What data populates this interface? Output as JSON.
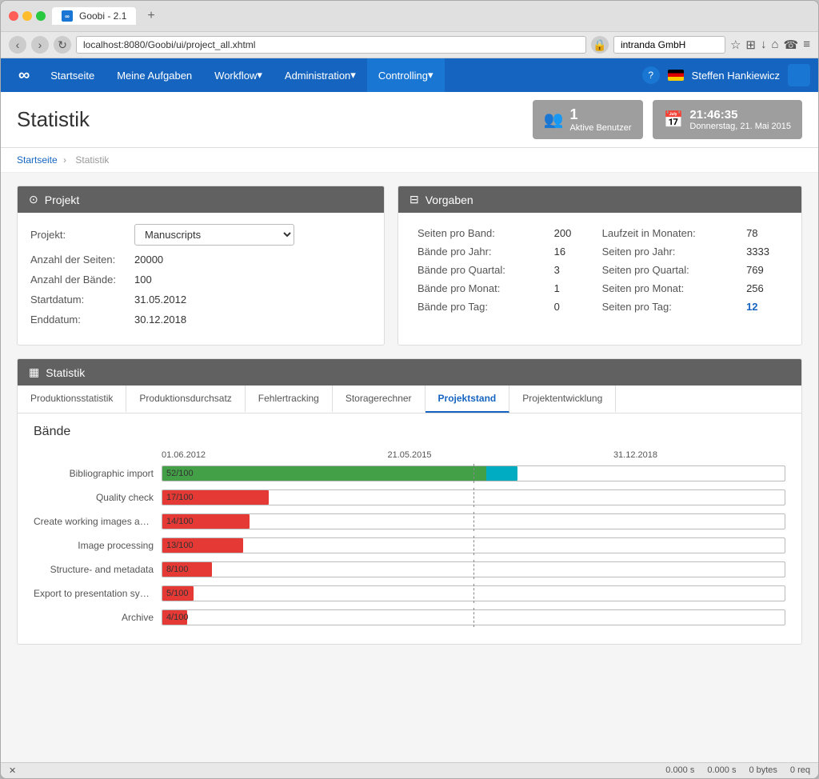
{
  "browser": {
    "tab_title": "Goobi - 2.1",
    "tab_icon": "∞",
    "address": "localhost:8080/Goobi/ui/project_all.xhtml",
    "search_placeholder": "intranda GmbH"
  },
  "nav": {
    "logo": "∞",
    "items": [
      {
        "label": "Startseite",
        "dropdown": false
      },
      {
        "label": "Meine Aufgaben",
        "dropdown": false
      },
      {
        "label": "Workflow",
        "dropdown": true
      },
      {
        "label": "Administration",
        "dropdown": true
      },
      {
        "label": "Controlling",
        "dropdown": true,
        "active": true
      }
    ],
    "help": "?",
    "username": "Steffen Hankiewicz"
  },
  "header": {
    "page_title": "Statistik",
    "widget_users_count": "1",
    "widget_users_label": "Aktive Benutzer",
    "widget_time": "21:46:35",
    "widget_date": "Donnerstag, 21. Mai 2015"
  },
  "breadcrumb": {
    "home": "Startseite",
    "separator": "›",
    "current": "Statistik"
  },
  "projekt": {
    "panel_title": "Projekt",
    "label_projekt": "Projekt:",
    "select_value": "Manuscripts",
    "label_seiten": "Anzahl der Seiten:",
    "value_seiten": "20000",
    "label_baende": "Anzahl der Bände:",
    "value_baende": "100",
    "label_startdatum": "Startdatum:",
    "value_startdatum": "31.05.2012",
    "label_enddatum": "Enddatum:",
    "value_enddatum": "30.12.2018"
  },
  "vorgaben": {
    "panel_title": "Vorgaben",
    "rows": [
      {
        "label": "Seiten pro Band:",
        "value": "200",
        "label2": "Laufzeit in Monaten:",
        "value2": "78"
      },
      {
        "label": "Bände pro Jahr:",
        "value": "16",
        "label2": "Seiten pro Jahr:",
        "value2": "3333"
      },
      {
        "label": "Bände pro Quartal:",
        "value": "3",
        "label2": "Seiten pro Quartal:",
        "value2": "769"
      },
      {
        "label": "Bände pro Monat:",
        "value": "1",
        "label2": "Seiten pro Monat:",
        "value2": "256"
      },
      {
        "label": "Bände pro Tag:",
        "value": "0",
        "label2": "Seiten pro Tag:",
        "value2": "12",
        "highlight2": true
      }
    ]
  },
  "statistik": {
    "panel_title": "Statistik",
    "tabs": [
      {
        "label": "Produktionsstatistik"
      },
      {
        "label": "Produktionsdurchsatz"
      },
      {
        "label": "Fehlertracking"
      },
      {
        "label": "Storagerechner"
      },
      {
        "label": "Projektstand",
        "active": true
      },
      {
        "label": "Projektentwicklung"
      }
    ],
    "baende_title": "Bände",
    "date_start": "01.06.2012",
    "date_mid": "21.05.2015",
    "date_end": "31.12.2018",
    "chart_rows": [
      {
        "label": "Bibliographic import",
        "value": 52,
        "max": 100,
        "pct_done": 52,
        "pct_inprogress": 5,
        "color": "green",
        "label_text": "52/100"
      },
      {
        "label": "Quality check",
        "value": 17,
        "max": 100,
        "pct_done": 17,
        "color": "red",
        "label_text": "17/100"
      },
      {
        "label": "Create working images and write tiff hea...",
        "value": 14,
        "max": 100,
        "pct_done": 14,
        "color": "red",
        "label_text": "14/100"
      },
      {
        "label": "Image processing",
        "value": 13,
        "max": 100,
        "pct_done": 13,
        "color": "red",
        "label_text": "13/100"
      },
      {
        "label": "Structure- and metadata",
        "value": 8,
        "max": 100,
        "pct_done": 8,
        "color": "red",
        "label_text": "8/100"
      },
      {
        "label": "Export to presentation system",
        "value": 5,
        "max": 100,
        "pct_done": 5,
        "color": "red",
        "label_text": "5/100"
      },
      {
        "label": "Archive",
        "value": 4,
        "max": 100,
        "pct_done": 4,
        "color": "red",
        "label_text": "4/100"
      }
    ],
    "vline_pct": 50
  },
  "statusbar": {
    "time1": "0.000 s",
    "time2": "0.000 s",
    "bytes": "0 bytes",
    "req": "0 req"
  }
}
